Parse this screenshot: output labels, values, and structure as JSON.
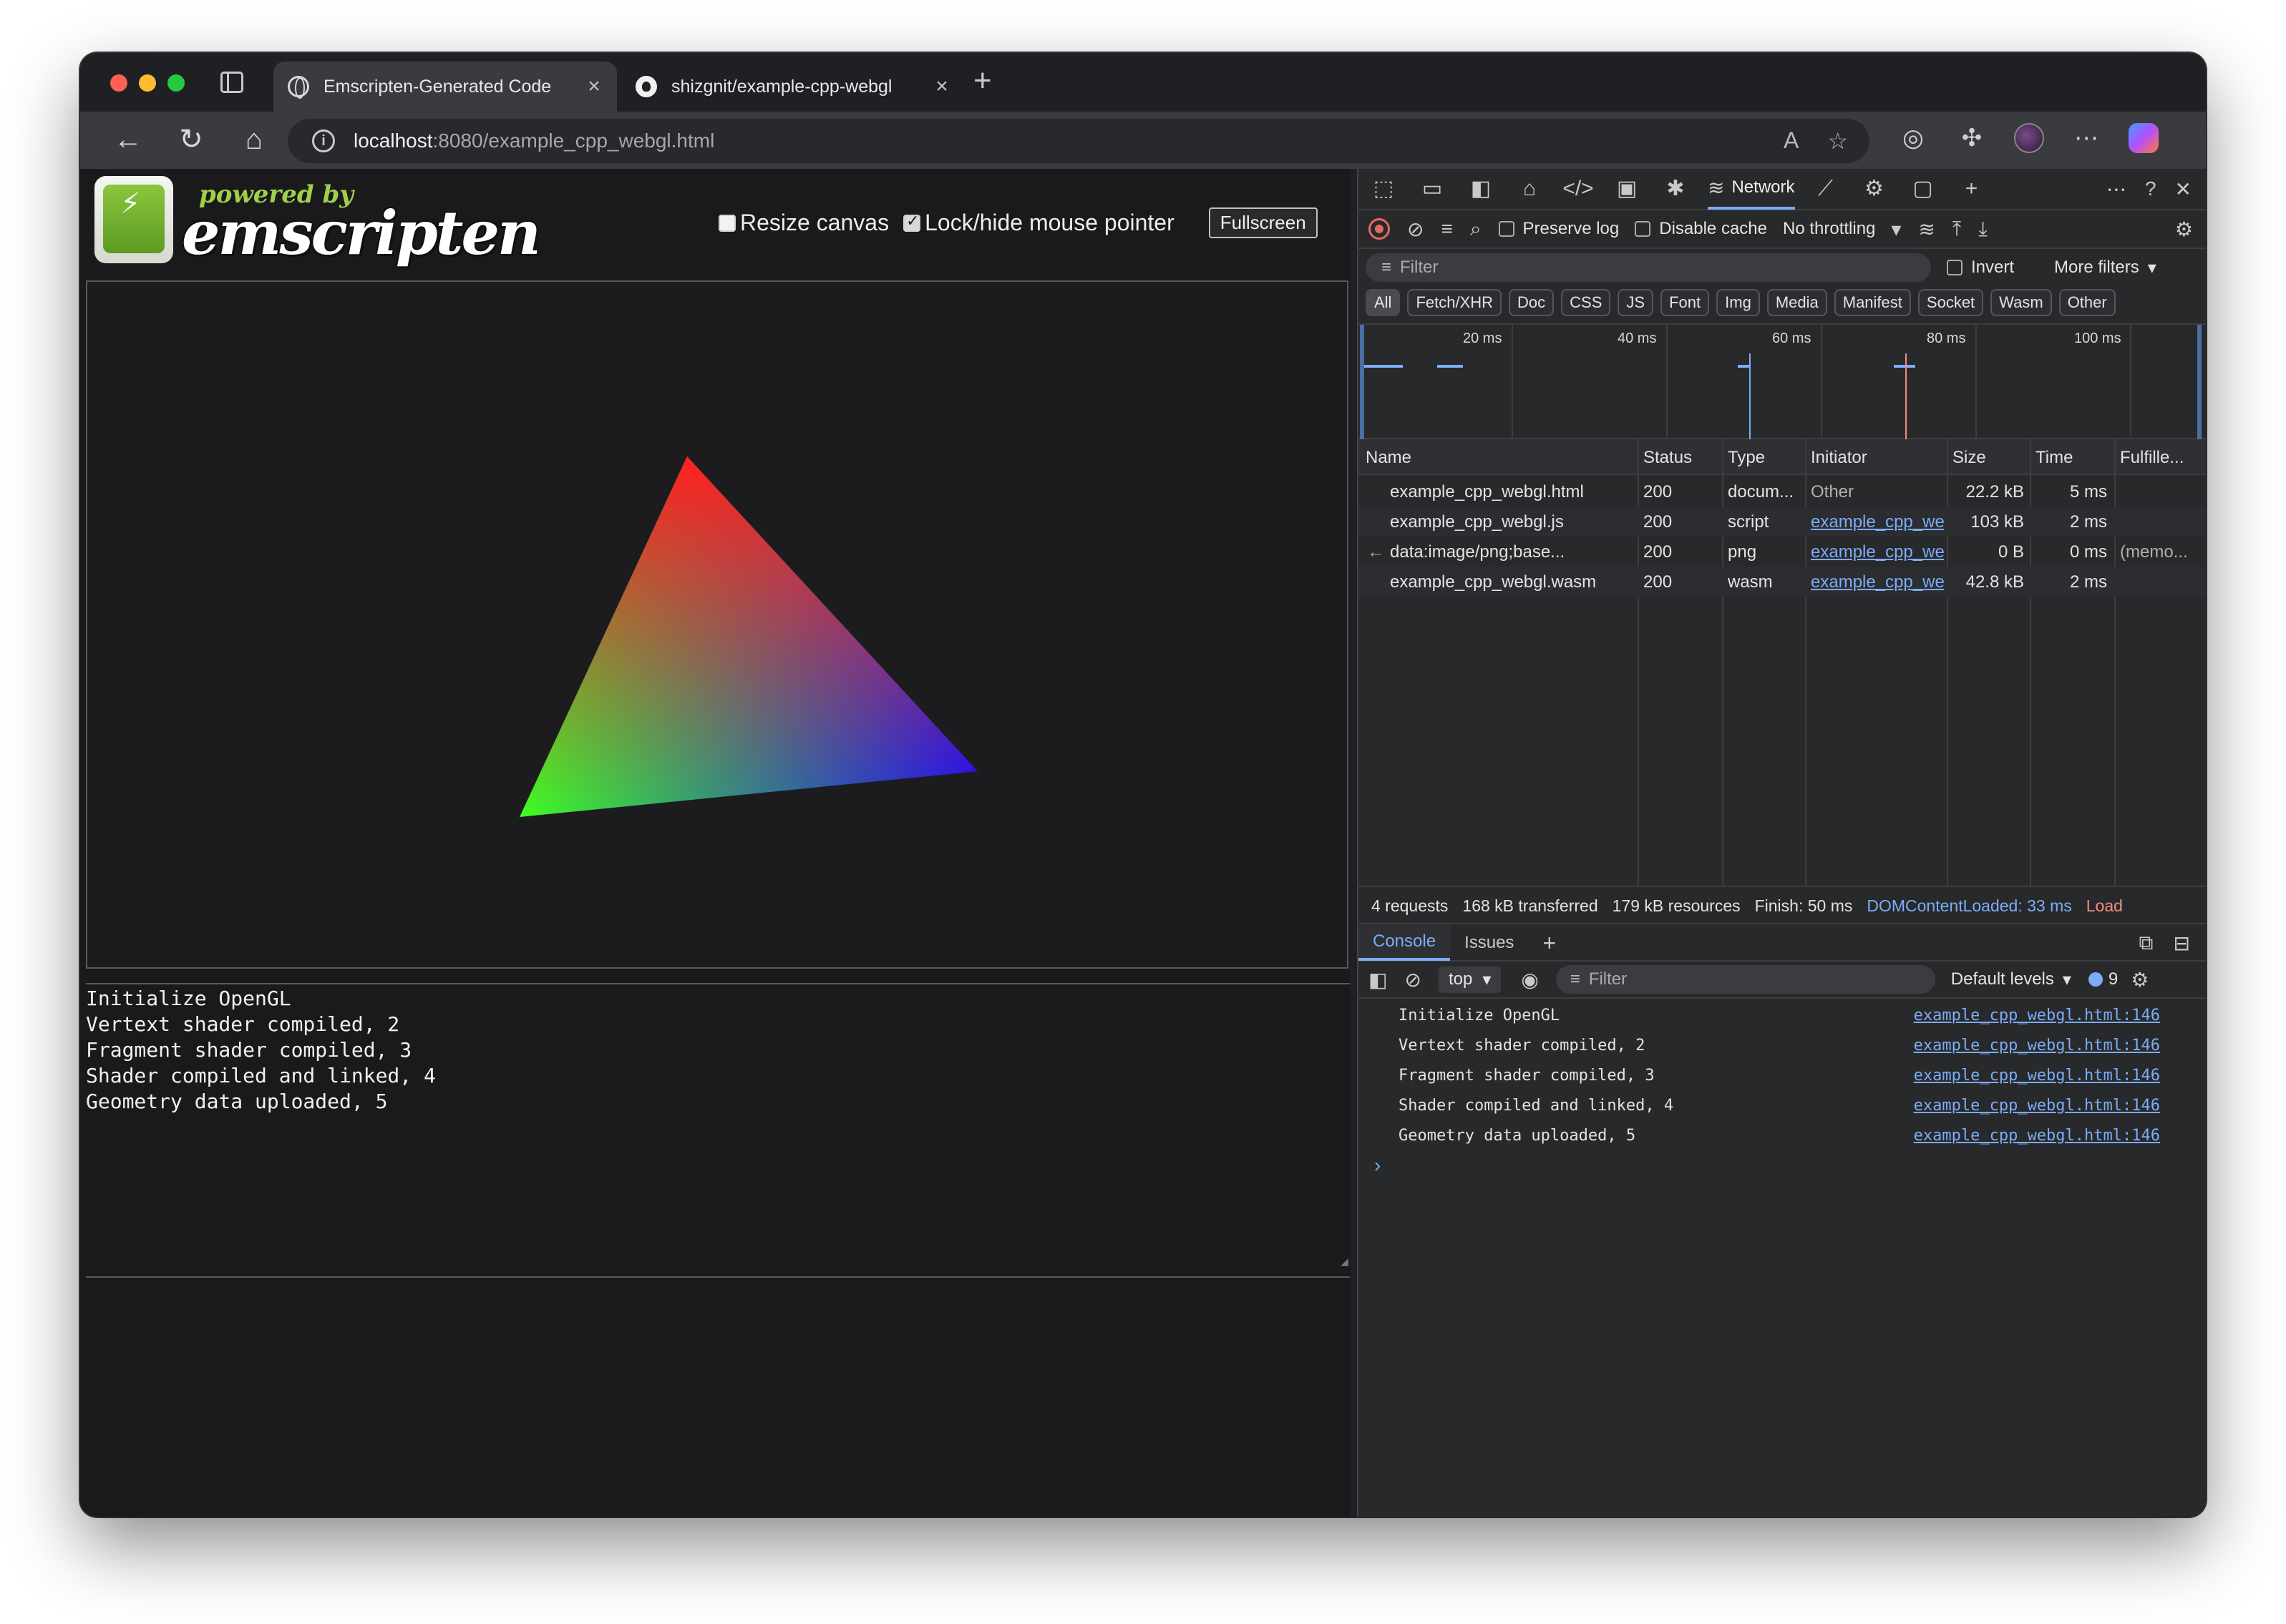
{
  "browser": {
    "tabs": [
      {
        "title": "Emscripten-Generated Code",
        "icon": "globe-icon",
        "active": true
      },
      {
        "title": "shizgnit/example-cpp-webgl",
        "icon": "github-icon",
        "active": false
      }
    ],
    "close_glyph": "×",
    "new_tab_glyph": "+",
    "url_host": "localhost",
    "url_path": ":8080/example_cpp_webgl.html"
  },
  "page": {
    "powered_by": "powered by",
    "brand": "emscripten",
    "resize_canvas_label": "Resize canvas",
    "resize_canvas_checked": false,
    "lock_pointer_label": "Lock/hide mouse pointer",
    "lock_pointer_checked": true,
    "fullscreen_label": "Fullscreen",
    "output_lines": [
      "Initialize OpenGL",
      "Vertext shader compiled, 2",
      "Fragment shader compiled, 3",
      "Shader compiled and linked, 4",
      "Geometry data uploaded, 5"
    ],
    "triangle_colors": {
      "top": "#ff2020",
      "bottom_left": "#40ff20",
      "bottom_right": "#1010ff"
    }
  },
  "devtools": {
    "active_panel": "Network",
    "preserve_log_label": "Preserve log",
    "disable_cache_label": "Disable cache",
    "throttling_label": "No throttling",
    "filter_placeholder": "Filter",
    "invert_label": "Invert",
    "more_filters_label": "More filters",
    "type_chips": [
      "All",
      "Fetch/XHR",
      "Doc",
      "CSS",
      "JS",
      "Font",
      "Img",
      "Media",
      "Manifest",
      "Socket",
      "Wasm",
      "Other"
    ],
    "timeline_labels": [
      "20 ms",
      "40 ms",
      "60 ms",
      "80 ms",
      "100 ms"
    ],
    "columns": [
      "Name",
      "Status",
      "Type",
      "Initiator",
      "Size",
      "Time",
      "Fulfille..."
    ],
    "rows": [
      {
        "name": "example_cpp_webgl.html",
        "status": "200",
        "type": "docum...",
        "initiator": "Other",
        "initiator_link": false,
        "size": "22.2 kB",
        "time": "5 ms",
        "fulfilled": ""
      },
      {
        "name": "example_cpp_webgl.js",
        "status": "200",
        "type": "script",
        "initiator": "example_cpp_we",
        "initiator_link": true,
        "size": "103 kB",
        "time": "2 ms",
        "fulfilled": ""
      },
      {
        "name": "data:image/png;base...",
        "status": "200",
        "type": "png",
        "initiator": "example_cpp_we",
        "initiator_link": true,
        "size": "0 B",
        "time": "0 ms",
        "fulfilled": "(memo..."
      },
      {
        "name": "example_cpp_webgl.wasm",
        "status": "200",
        "type": "wasm",
        "initiator": "example_cpp_we",
        "initiator_link": true,
        "size": "42.8 kB",
        "time": "2 ms",
        "fulfilled": ""
      }
    ],
    "summary": {
      "requests": "4 requests",
      "transferred": "168 kB transferred",
      "resources": "179 kB resources",
      "finish": "Finish: 50 ms",
      "dcl": "DOMContentLoaded: 33 ms",
      "load": "Load"
    },
    "drawer_tabs": [
      "Console",
      "Issues"
    ],
    "console_context": "top",
    "console_filter_placeholder": "Filter",
    "default_levels_label": "Default levels",
    "message_count": "9",
    "console_messages": [
      {
        "text": "Initialize OpenGL",
        "source": "example_cpp_webgl.html:146"
      },
      {
        "text": "Vertext shader compiled, 2",
        "source": "example_cpp_webgl.html:146"
      },
      {
        "text": "Fragment shader compiled, 3",
        "source": "example_cpp_webgl.html:146"
      },
      {
        "text": "Shader compiled and linked, 4",
        "source": "example_cpp_webgl.html:146"
      },
      {
        "text": "Geometry data uploaded, 5",
        "source": "example_cpp_webgl.html:146"
      }
    ],
    "prompt_glyph": "›"
  }
}
